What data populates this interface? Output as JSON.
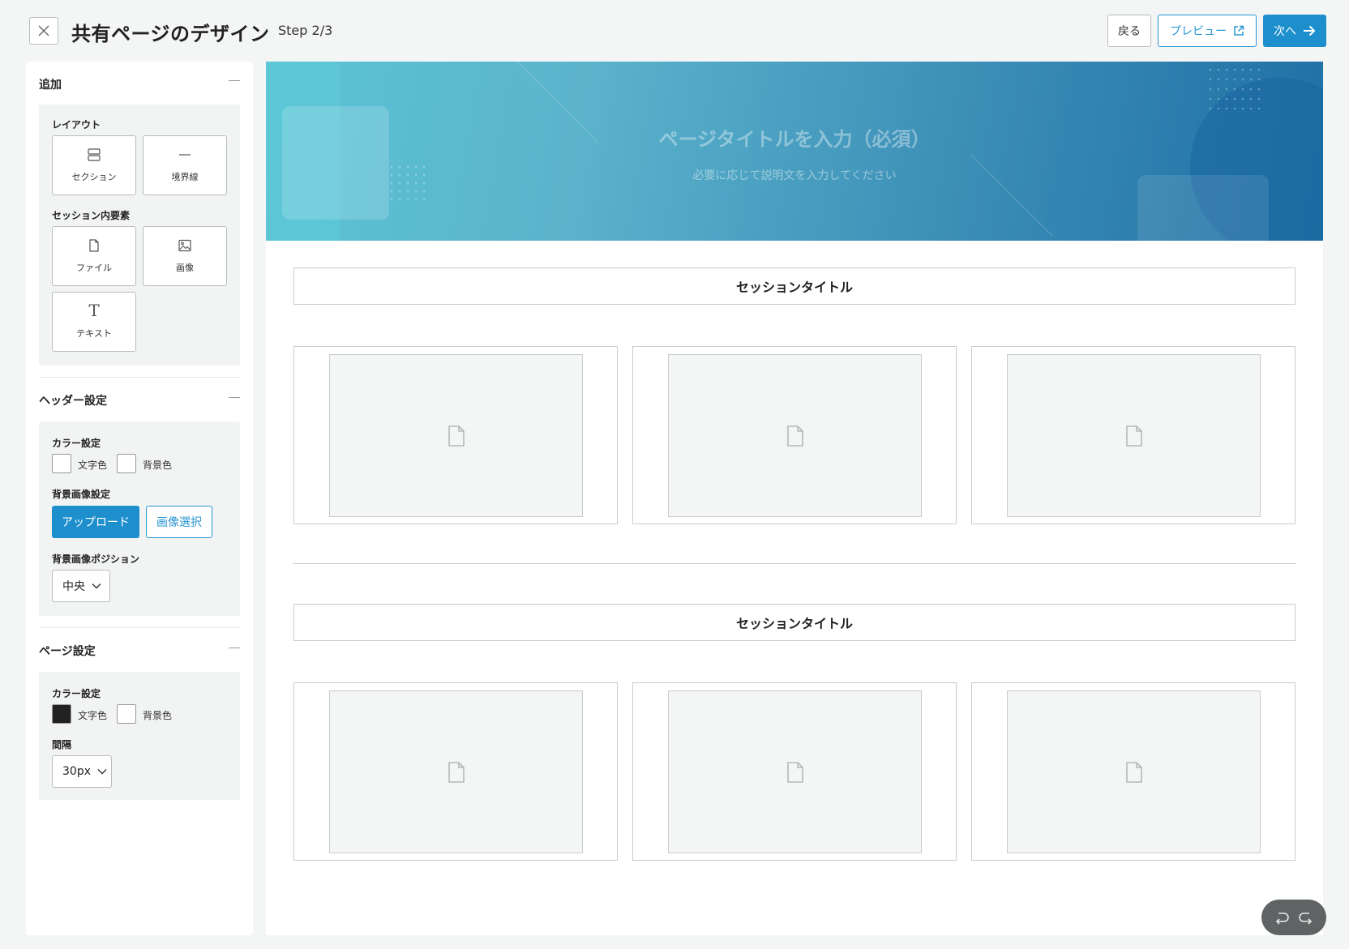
{
  "header": {
    "title": "共有ページのデザイン",
    "step": "Step 2/3",
    "back_label": "戻る",
    "preview_label": "プレビュー",
    "next_label": "次へ"
  },
  "sidebar": {
    "add": {
      "title": "追加",
      "layout_label": "レイアウト",
      "layout_items": [
        {
          "label": "セクション",
          "icon": "section-icon"
        },
        {
          "label": "境界線",
          "icon": "divider-icon"
        }
      ],
      "session_label": "セッション内要素",
      "session_items": [
        {
          "label": "ファイル",
          "icon": "file-icon"
        },
        {
          "label": "画像",
          "icon": "image-icon"
        },
        {
          "label": "テキスト",
          "icon": "text-icon"
        }
      ]
    },
    "header_settings": {
      "title": "ヘッダー設定",
      "color_label": "カラー設定",
      "text_color_label": "文字色",
      "bg_color_label": "背景色",
      "text_color": "#ffffff",
      "bg_color": "#ffffff",
      "bg_image_label": "背景画像設定",
      "upload_label": "アップロード",
      "select_image_label": "画像選択",
      "position_label": "背景画像ポジション",
      "position_value": "中央"
    },
    "page_settings": {
      "title": "ページ設定",
      "color_label": "カラー設定",
      "text_color_label": "文字色",
      "bg_color_label": "背景色",
      "text_color": "#222222",
      "bg_color": "#ffffff",
      "spacing_label": "間隔",
      "spacing_value": "30px"
    }
  },
  "canvas": {
    "hero_title_placeholder": "ページタイトルを入力（必須）",
    "hero_desc_placeholder": "必要に応じて説明文を入力してください",
    "sections": [
      {
        "title": "セッションタイトル",
        "cards": [
          "file-placeholder",
          "file-placeholder",
          "file-placeholder"
        ]
      },
      {
        "title": "セッションタイトル",
        "cards": [
          "file-placeholder",
          "file-placeholder",
          "file-placeholder"
        ]
      }
    ]
  },
  "colors": {
    "accent": "#1e8fcd",
    "hero_start": "#5bc4d6",
    "hero_end": "#1f6fa5"
  }
}
